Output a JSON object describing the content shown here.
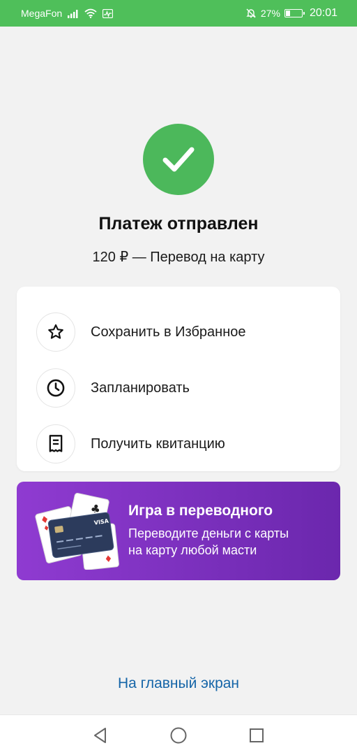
{
  "status_bar": {
    "carrier": "MegaFon",
    "battery_percent": "27%",
    "battery_level": 0.27,
    "time": "20:01",
    "icons": [
      "signal-icon",
      "wifi-icon",
      "activity-icon",
      "mute-icon",
      "battery-icon"
    ]
  },
  "success": {
    "icon": "checkmark-icon",
    "title": "Платеж отправлен",
    "subtitle": "120 ₽ — Перевод на карту"
  },
  "actions": [
    {
      "icon": "star-icon",
      "label": "Сохранить в Избранное"
    },
    {
      "icon": "clock-icon",
      "label": "Запланировать"
    },
    {
      "icon": "receipt-icon",
      "label": "Получить квитанцию"
    }
  ],
  "promo": {
    "title": "Игра в переводного",
    "line1": "Переводите деньги с карты",
    "line2": "на карту любой масти",
    "card_brand": "VISA",
    "colors": {
      "start": "#8f3bd1",
      "end": "#6b27ad"
    }
  },
  "home_link": "На главный экран",
  "navigation": [
    "back-icon",
    "home-icon",
    "recents-icon"
  ],
  "colors": {
    "status_bar": "#4fbf5a",
    "success": "#4cb85b",
    "link": "#1565a8",
    "background": "#f2f2f2"
  }
}
